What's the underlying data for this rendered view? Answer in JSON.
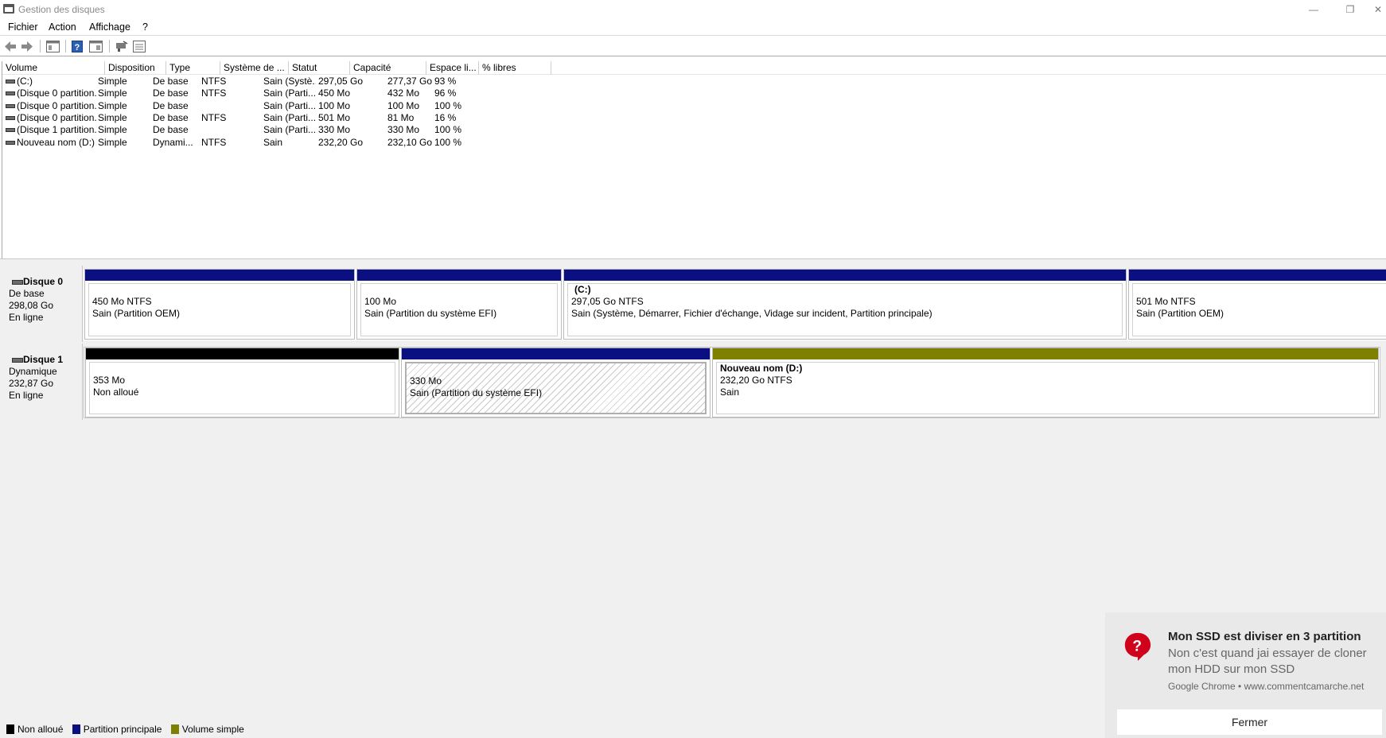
{
  "window": {
    "title": "Gestion des disques",
    "minimize": "—",
    "restore": "❐",
    "close": "✕"
  },
  "menu": [
    "Fichier",
    "Action",
    "Affichage",
    "?"
  ],
  "toolbar_icons": [
    "back-arrow-icon",
    "forward-arrow-icon",
    "console-tree-icon",
    "help-icon",
    "properties-icon",
    "connect-icon",
    "list-view-icon"
  ],
  "table": {
    "columns": [
      "Volume",
      "Disposition",
      "Type",
      "Système de ...",
      "Statut",
      "Capacité",
      "Espace li...",
      "% libres"
    ],
    "rows": [
      [
        "(C:)",
        "Simple",
        "De base",
        "NTFS",
        "Sain (Systè...",
        "297,05 Go",
        "277,37 Go",
        "93 %"
      ],
      [
        "(Disque 0 partition...",
        "Simple",
        "De base",
        "NTFS",
        "Sain (Parti...",
        "450 Mo",
        "432 Mo",
        "96 %"
      ],
      [
        "(Disque 0 partition...",
        "Simple",
        "De base",
        "",
        "Sain (Parti...",
        "100 Mo",
        "100 Mo",
        "100 %"
      ],
      [
        "(Disque 0 partition...",
        "Simple",
        "De base",
        "NTFS",
        "Sain (Parti...",
        "501 Mo",
        "81 Mo",
        "16 %"
      ],
      [
        "(Disque 1 partition...",
        "Simple",
        "De base",
        "",
        "Sain (Parti...",
        "330 Mo",
        "330 Mo",
        "100 %"
      ],
      [
        "Nouveau nom (D:)",
        "Simple",
        "Dynami...",
        "NTFS",
        "Sain",
        "232,20 Go",
        "232,10 Go",
        "100 %"
      ]
    ]
  },
  "disks": [
    {
      "name": "Disque 0",
      "type": "De base",
      "size": "298,08 Go",
      "state": "En ligne",
      "partitions": [
        {
          "title": "",
          "line1": "450 Mo NTFS",
          "line2": "Sain (Partition OEM)",
          "color": "#0a0f82"
        },
        {
          "title": "",
          "line1": "100 Mo",
          "line2": "Sain (Partition du système EFI)",
          "color": "#0a0f82"
        },
        {
          "title": "(C:)",
          "line1": "297,05 Go NTFS",
          "line2": "Sain (Système, Démarrer, Fichier d'échange, Vidage sur incident, Partition principale)",
          "color": "#0a0f82"
        },
        {
          "title": "",
          "line1": "501 Mo NTFS",
          "line2": "Sain (Partition OEM)",
          "color": "#0a0f82"
        }
      ]
    },
    {
      "name": "Disque 1",
      "type": "Dynamique",
      "size": "232,87 Go",
      "state": "En ligne",
      "partitions": [
        {
          "title": "",
          "line1": "353 Mo",
          "line2": "Non alloué",
          "color": "#000000"
        },
        {
          "title": "",
          "line1": "330 Mo",
          "line2": "Sain (Partition du système EFI)",
          "color": "#0a0f82"
        },
        {
          "title": "Nouveau nom  (D:)",
          "line1": "232,20 Go NTFS",
          "line2": "Sain",
          "color": "#7f7f00"
        }
      ]
    }
  ],
  "legend": [
    {
      "label": "Non alloué",
      "color": "#000000"
    },
    {
      "label": "Partition principale",
      "color": "#0a0f82"
    },
    {
      "label": "Volume simple",
      "color": "#7f7f00"
    }
  ],
  "notification": {
    "title": "Mon SSD est diviser en 3 partition",
    "body": "Non c'est quand jai essayer de cloner mon HDD sur mon SSD",
    "source": "Google Chrome • www.commentcamarche.net",
    "button": "Fermer",
    "icon": "question-bubble-icon",
    "icon_color": "#d0021b"
  }
}
